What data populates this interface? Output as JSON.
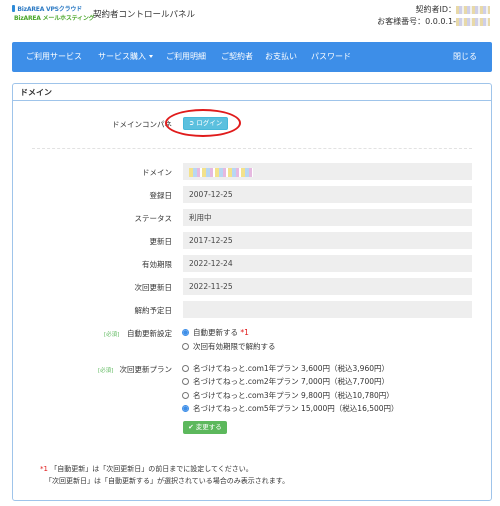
{
  "header": {
    "logo_line1": "BizAREA VPSクラウド",
    "logo_line2": "BizAREA メールホスティング",
    "panel_title": "契約者コントロールパネル",
    "account_label": "契約者ID：",
    "customer_no_label": "お客様番号：0.0.0.1-"
  },
  "nav": {
    "items": [
      {
        "label": "ご利用サービス"
      },
      {
        "label": "サービス購入"
      },
      {
        "label": "ご利用明細"
      },
      {
        "label": "ご契約者"
      },
      {
        "label": "お支払い"
      },
      {
        "label": "パスワード"
      }
    ],
    "close_label": "閉じる"
  },
  "card": {
    "title": "ドメイン"
  },
  "control_panel": {
    "label": "ドメインコンパネ",
    "login_button": "ログイン",
    "login_icon": "sign-in-icon"
  },
  "fields": {
    "domain_label": "ドメイン",
    "registered_label": "登録日",
    "registered_value": "2007-12-25",
    "status_label": "ステータス",
    "status_value": "利用中",
    "updated_label": "更新日",
    "updated_value": "2017-12-25",
    "expiry_label": "有効期限",
    "expiry_value": "2022-12-24",
    "next_renewal_label": "次回更新日",
    "next_renewal_value": "2022-11-25",
    "cancel_label": "解約予定日",
    "cancel_value": ""
  },
  "auto_renew": {
    "required": "[必須]",
    "label": "自動更新設定",
    "options": [
      {
        "label": "自動更新する",
        "mark": "*1",
        "selected": true
      },
      {
        "label": "次回有効期限で解約する",
        "selected": false
      }
    ]
  },
  "renew_plan": {
    "required": "[必須]",
    "label": "次回更新プラン",
    "options": [
      {
        "label": "名づけてねっと.com1年プラン 3,600円（税込3,960円）",
        "selected": false
      },
      {
        "label": "名づけてねっと.com2年プラン 7,000円（税込7,700円）",
        "selected": false
      },
      {
        "label": "名づけてねっと.com3年プラン 9,800円（税込10,780円）",
        "selected": false
      },
      {
        "label": "名づけてねっと.com5年プラン 15,000円（税込16,500円）",
        "selected": true
      }
    ]
  },
  "submit": {
    "label": "変更する",
    "icon": "check-icon"
  },
  "notes": {
    "mark": "*1",
    "line1": "「自動更新」は「次回更新日」の前日までに設定してください。",
    "line2": "「次回更新日」は「自動更新する」が選択されている場合のみ表示されます。"
  },
  "colors": {
    "nav_bg": "#3d8ee8",
    "login_button": "#5bc0de",
    "submit_button": "#5cb85c",
    "highlight_ring": "#e01b1b"
  }
}
